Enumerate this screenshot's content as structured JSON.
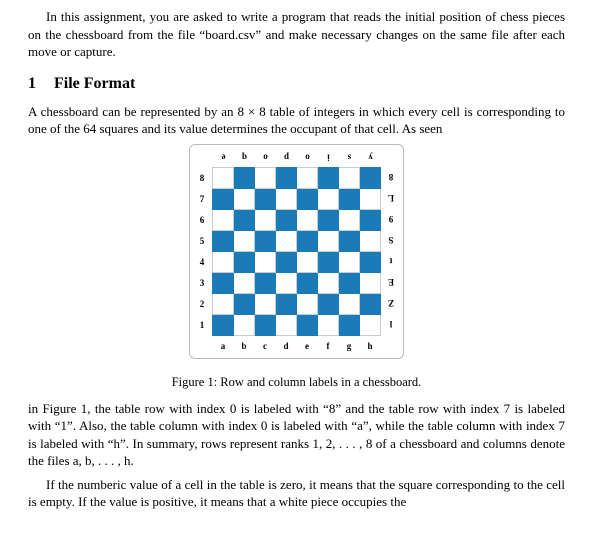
{
  "intro": "In this assignment, you are asked to write a program that reads the initial position of chess pieces on the chessboard from the file “board.csv” and make necessary changes on the same file after each move or capture.",
  "section": {
    "num": "1",
    "title": "File Format"
  },
  "para1": "A chessboard can be represented by an 8 × 8 table of integers in which every cell is corresponding to one of the 64 squares and its value determines the occupant of that cell. As seen",
  "board": {
    "files_top": [
      "e",
      "q",
      "o",
      "p",
      "o",
      "i",
      "s",
      "y"
    ],
    "files_bottom": [
      "a",
      "b",
      "c",
      "d",
      "e",
      "f",
      "g",
      "h"
    ],
    "ranks_left": [
      "8",
      "7",
      "6",
      "5",
      "4",
      "3",
      "2",
      "1"
    ],
    "ranks_right": [
      "8",
      "L",
      "9",
      "S",
      "t",
      "E",
      "Z",
      "l"
    ]
  },
  "caption": "Figure 1: Row and column labels in a chessboard.",
  "para2": "in Figure 1, the table row with index 0 is labeled with “8” and the table row with index 7 is labeled with “1”. Also, the table column with index 0 is labeled with “a”, while the table column with index 7 is labeled with “h”. In summary, rows represent ranks 1, 2, . . . , 8 of a chessboard and columns denote the files a, b, . . . , h.",
  "para3": "If the numberic value of a cell in the table is zero, it means that the square corresponding to the cell is empty.  If the value is positive, it means that a white piece occupies the"
}
